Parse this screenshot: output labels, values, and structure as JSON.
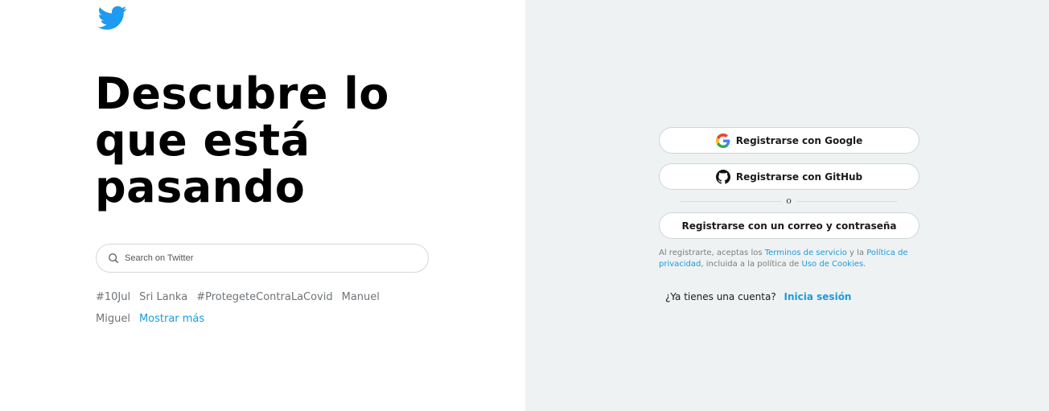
{
  "colors": {
    "brand": "#1d9bf0",
    "link": "#1d9bd9",
    "right_panel_bg": "#eff2f3"
  },
  "logo": {
    "icon": "twitter-bird-icon"
  },
  "headline": {
    "line1": "Descubre lo",
    "line2": "que está",
    "line3": "pasando"
  },
  "search": {
    "placeholder": "Search on Twitter",
    "value": ""
  },
  "trends": {
    "items": [
      "#10Jul",
      "Sri Lanka",
      "#ProtegeteContraLaCovid",
      "Manuel",
      "Miguel"
    ],
    "more": "Mostrar más"
  },
  "signup": {
    "google_label": "Registrarse con Google",
    "github_label": "Registrarse con GitHub",
    "divider": "o",
    "email_label": "Registrarse con un correo y contraseña"
  },
  "terms": {
    "prefix": "Al registrarte, aceptas los ",
    "terms_link": "Terminos de servicio",
    "and": " y la ",
    "privacy_link": "Política de privacidad",
    "middle": ", incluida a la política de ",
    "cookies_link": "Uso de Cookies",
    "end": "."
  },
  "login": {
    "question": "¿Ya tienes una cuenta?",
    "link": "Inicia sesión"
  }
}
